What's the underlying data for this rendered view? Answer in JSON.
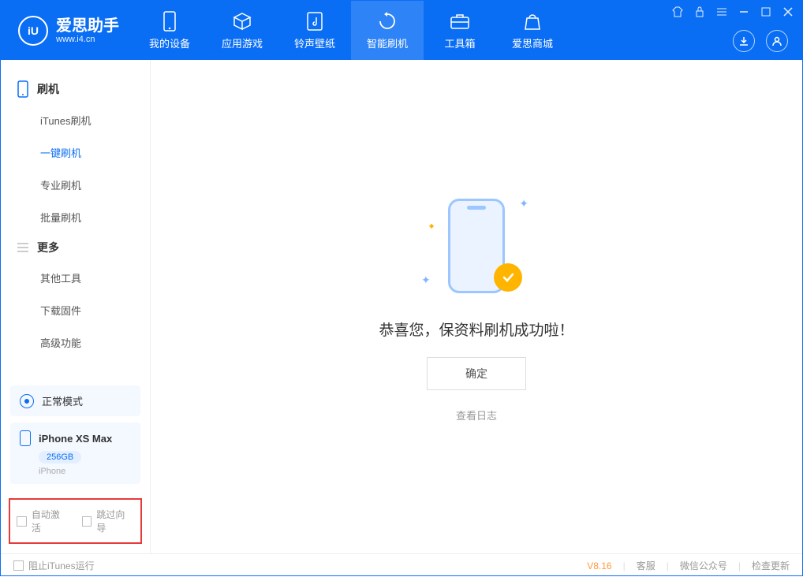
{
  "app": {
    "name": "爱思助手",
    "url": "www.i4.cn"
  },
  "header_tabs": [
    {
      "label": "我的设备"
    },
    {
      "label": "应用游戏"
    },
    {
      "label": "铃声壁纸"
    },
    {
      "label": "智能刷机"
    },
    {
      "label": "工具箱"
    },
    {
      "label": "爱思商城"
    }
  ],
  "sidebar": {
    "group1": {
      "title": "刷机",
      "items": [
        "iTunes刷机",
        "一键刷机",
        "专业刷机",
        "批量刷机"
      ]
    },
    "group2": {
      "title": "更多",
      "items": [
        "其他工具",
        "下载固件",
        "高级功能"
      ]
    }
  },
  "mode": {
    "label": "正常模式"
  },
  "device": {
    "name": "iPhone XS Max",
    "storage": "256GB",
    "type": "iPhone"
  },
  "checks": {
    "auto_activate": "自动激活",
    "skip_guide": "跳过向导"
  },
  "main": {
    "success_text": "恭喜您，保资料刷机成功啦！",
    "confirm": "确定",
    "view_log": "查看日志"
  },
  "footer": {
    "block_itunes": "阻止iTunes运行",
    "version": "V8.16",
    "support": "客服",
    "wechat": "微信公众号",
    "update": "检查更新"
  }
}
